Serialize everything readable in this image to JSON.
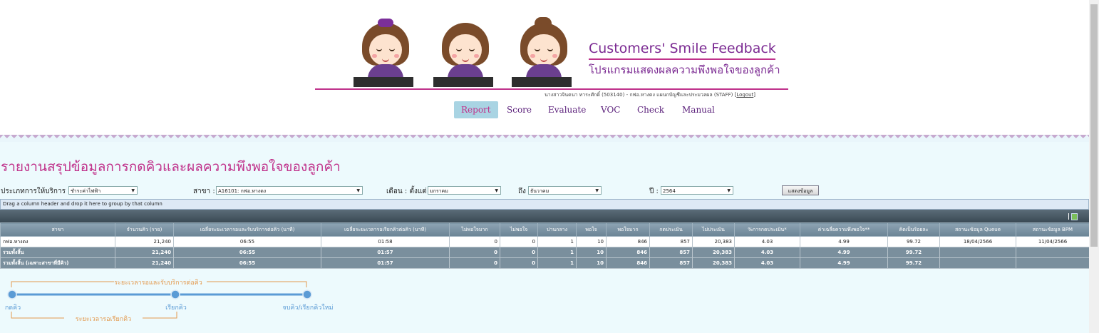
{
  "header": {
    "title": "Customers' Smile Feedback",
    "subtitle": "โปรแกรมแสดงผลความพึงพอใจของลูกค้า",
    "user_text": "นางสาวจินดนา ทาระศักดิ์ (503140) - กฟอ.หางดง แผนกบัญชีและประมวลผล (STAFF)",
    "logout_label": "Logout"
  },
  "nav": [
    {
      "label": "Report",
      "active": true
    },
    {
      "label": "Score"
    },
    {
      "label": "Evaluate"
    },
    {
      "label": "VOC"
    },
    {
      "label": "Check"
    },
    {
      "label": "Manual"
    }
  ],
  "page_title": "รายงานสรุปข้อมูลการกดคิวและผลความพึงพอใจของลูกค้า",
  "filters": {
    "service_type_label": "ประเภทการให้บริการ :",
    "service_type_value": "ชำระค่าไฟฟ้า",
    "branch_label": "สาขา :",
    "branch_value": "A16101: กฟอ.หางดง",
    "month_from_label": "เดือน : ตั้งแต่",
    "month_from_value": "มกราคม",
    "month_to_label": "ถึง",
    "month_to_value": "ธันวาคม",
    "year_label": "ปี :",
    "year_value": "2564",
    "show_button": "แสดงข้อมูล"
  },
  "grid": {
    "group_hint": "Drag a column header and drop it here to group by that column",
    "columns": [
      "สาขา",
      "จำนวนคิว (ราย)",
      "เฉลี่ยระยะเวลารอและรับบริการต่อคิว (นาที)",
      "เฉลี่ยระยะเวลารอเรียกคิวต่อคิว (นาที)",
      "ไม่พอใจมาก",
      "ไม่พอใจ",
      "ปานกลาง",
      "พอใจ",
      "พอใจมาก",
      "กดประเมิน",
      "ไม่ประเมิน",
      "%การกดประเมิน*",
      "ค่าเฉลี่ยความพึงพอใจ**",
      "คิดเป็นร้อยละ",
      "สถานะข้อมูล Queue",
      "สถานะข้อมูล BPM"
    ],
    "rows": [
      [
        "กฟอ.หางดง",
        "21,240",
        "06:55",
        "01:58",
        "0",
        "0",
        "1",
        "10",
        "846",
        "857",
        "20,383",
        "4.03",
        "4.99",
        "99.72",
        "18/04/2566",
        "11/04/2566"
      ]
    ],
    "totals": [
      [
        "รวมทั้งสิ้น",
        "21,240",
        "06:55",
        "01:57",
        "0",
        "0",
        "1",
        "10",
        "846",
        "857",
        "20,383",
        "4.03",
        "4.99",
        "99.72",
        "",
        ""
      ],
      [
        "รวมทั้งสิ้น (เฉพาะสาขาที่มีคิว)",
        "21,240",
        "06:55",
        "01:57",
        "0",
        "0",
        "1",
        "10",
        "846",
        "857",
        "20,383",
        "4.03",
        "4.99",
        "99.72",
        "",
        ""
      ]
    ]
  },
  "timeline": {
    "top_label": "ระยะเวลารอและรับบริการต่อคิว",
    "bottom_label": "ระยะเวลารอเรียกคิว",
    "point1": "กดคิว",
    "point2": "เรียกคิว",
    "point3": "จบคิว/เรียกคิวใหม่"
  },
  "colors": {
    "accent": "#c0328b",
    "nav_text": "#5a1f7a",
    "timeline_line": "#5b9bd5",
    "timeline_bracket": "#e39a4f"
  }
}
